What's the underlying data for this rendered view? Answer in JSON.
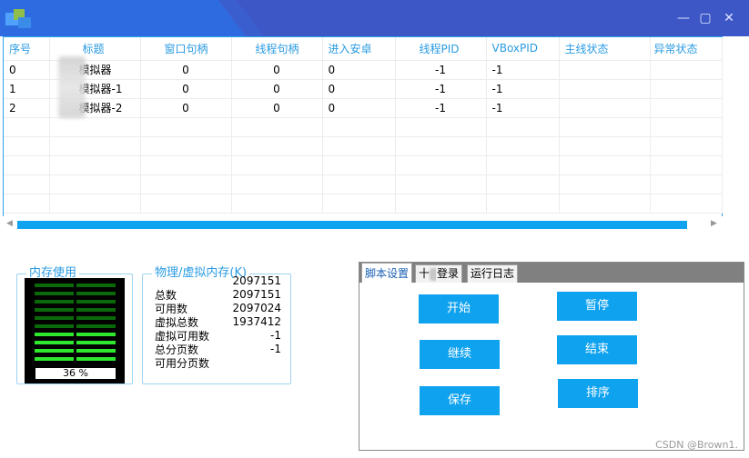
{
  "window": {
    "minimize_glyph": "—",
    "maximize_glyph": "▢",
    "close_glyph": "✕"
  },
  "grid": {
    "columns": [
      "序号",
      "标题",
      "窗口句柄",
      "线程句柄",
      "进入安卓",
      "线程PID",
      "VBoxPID",
      "主线状态",
      "异常状态"
    ],
    "rows": [
      [
        "0",
        "模拟器",
        "0",
        "0",
        "0",
        "-1",
        "-1",
        "",
        ""
      ],
      [
        "1",
        "模拟器-1",
        "0",
        "0",
        "0",
        "-1",
        "-1",
        "",
        ""
      ],
      [
        "2",
        "模拟器-2",
        "0",
        "0",
        "0",
        "-1",
        "-1",
        "",
        ""
      ]
    ]
  },
  "memory": {
    "legend": "内存使用",
    "percent_text": "36 %",
    "used_fraction": 0.36,
    "bar_count": 10,
    "bar_bright": "#2ee82e",
    "bar_dim": "#0a6a0a"
  },
  "physical": {
    "legend": "物理/虚拟内存(K)",
    "labels": [
      "总数",
      "可用数",
      "虚拟总数",
      "虚拟可用数",
      "总分页数",
      "可用分页数"
    ],
    "values": [
      "2097151",
      "2097151",
      "2097024",
      "1937412",
      "-1",
      "-1"
    ]
  },
  "tabs": {
    "items": [
      "脚本设置",
      "十",
      "登录",
      "运行日志"
    ],
    "active_index": 0
  },
  "buttons": {
    "start": "开始",
    "pause": "暂停",
    "continue": "继续",
    "end": "结束",
    "save": "保存",
    "sort": "排序"
  },
  "watermark": "CSDN @Brown1."
}
